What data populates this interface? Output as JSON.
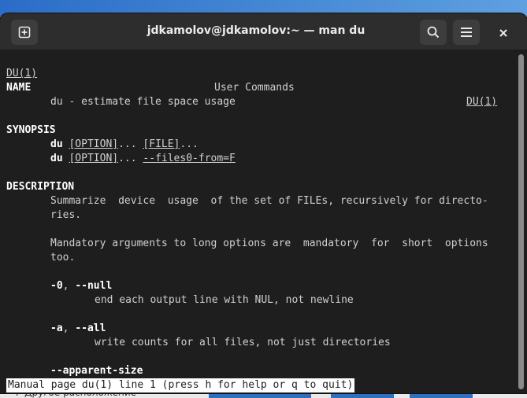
{
  "window": {
    "title": "jdkamolov@jdkamolov:~ — man du",
    "new_tab_icon": "new-tab-icon",
    "search_icon": "search-icon",
    "menu_icon": "hamburger-menu-icon",
    "close_icon": "close-icon"
  },
  "man": {
    "header_left": "DU(1)",
    "header_center": "User Commands",
    "header_right": "DU(1)",
    "name_heading": "NAME",
    "name_text": "du - estimate file space usage",
    "synopsis_heading": "SYNOPSIS",
    "synopsis_1": {
      "cmd": "du",
      "opt": "[OPTION]",
      "mid": "... ",
      "file": "[FILE]",
      "end": "..."
    },
    "synopsis_2": {
      "cmd": "du",
      "opt": "[OPTION]",
      "mid": "... ",
      "file": "--files0-from=F",
      "end": ""
    },
    "description_heading": "DESCRIPTION",
    "desc_1a": "Summarize  device  usage  of the set of FILEs, recursively for directo-",
    "desc_1b": "ries.",
    "desc_2a": "Mandatory arguments to long options are  mandatory  for  short  options",
    "desc_2b": "too.",
    "opt_0_flag": "-0",
    "opt_0_sep": ", ",
    "opt_0_long": "--null",
    "opt_0_desc": "end each output line with NUL, not newline",
    "opt_a_flag": "-a",
    "opt_a_sep": ", ",
    "opt_a_long": "--all",
    "opt_a_desc": "write counts for all files, not just directories",
    "opt_apparent": "--apparent-size"
  },
  "status_line": "Manual page du(1) line 1 (press h for help or q to quit)",
  "desktop_bottom_text": "Г Другое расположение"
}
